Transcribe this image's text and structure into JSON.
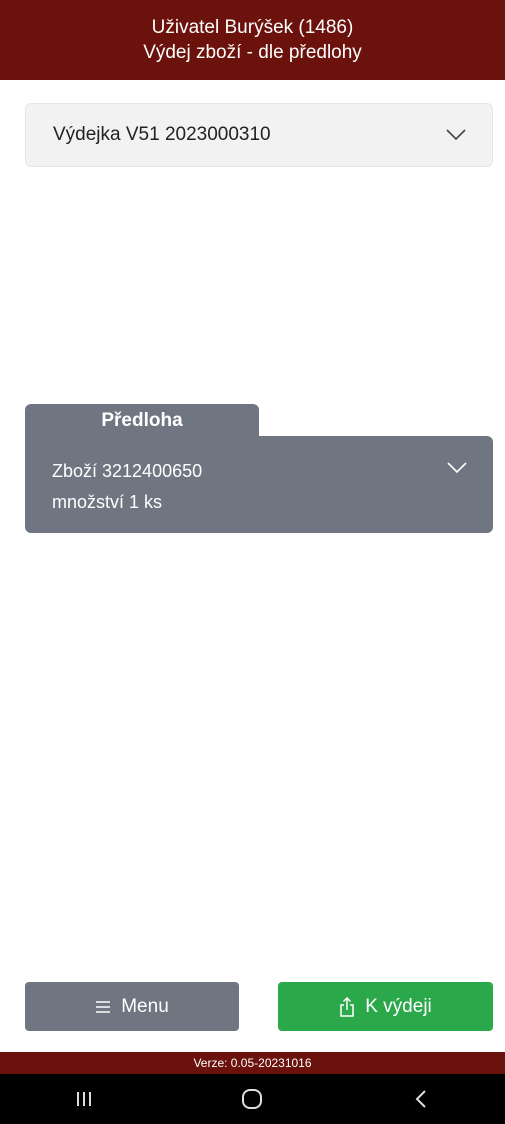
{
  "header": {
    "user_line": "Uživatel Burýšek (1486)",
    "title": "Výdej zboží - dle předlohy"
  },
  "document_select": {
    "value": "Výdejka V51 2023000310",
    "icon": "chevron-down-icon"
  },
  "template_panel": {
    "tab_label": "Předloha",
    "item_label": "Zboží 3212400650",
    "quantity_label": "množství 1 ks",
    "icon": "chevron-down-icon"
  },
  "buttons": {
    "menu": {
      "label": "Menu",
      "icon": "hamburger-icon"
    },
    "issue": {
      "label": "K výdeji",
      "icon": "share-icon"
    }
  },
  "footer": {
    "version": "Verze: 0.05-20231016"
  },
  "colors": {
    "header_bg": "#6a120b",
    "panel_bg": "#6f7681",
    "issue_button_bg": "#2aa84a"
  }
}
